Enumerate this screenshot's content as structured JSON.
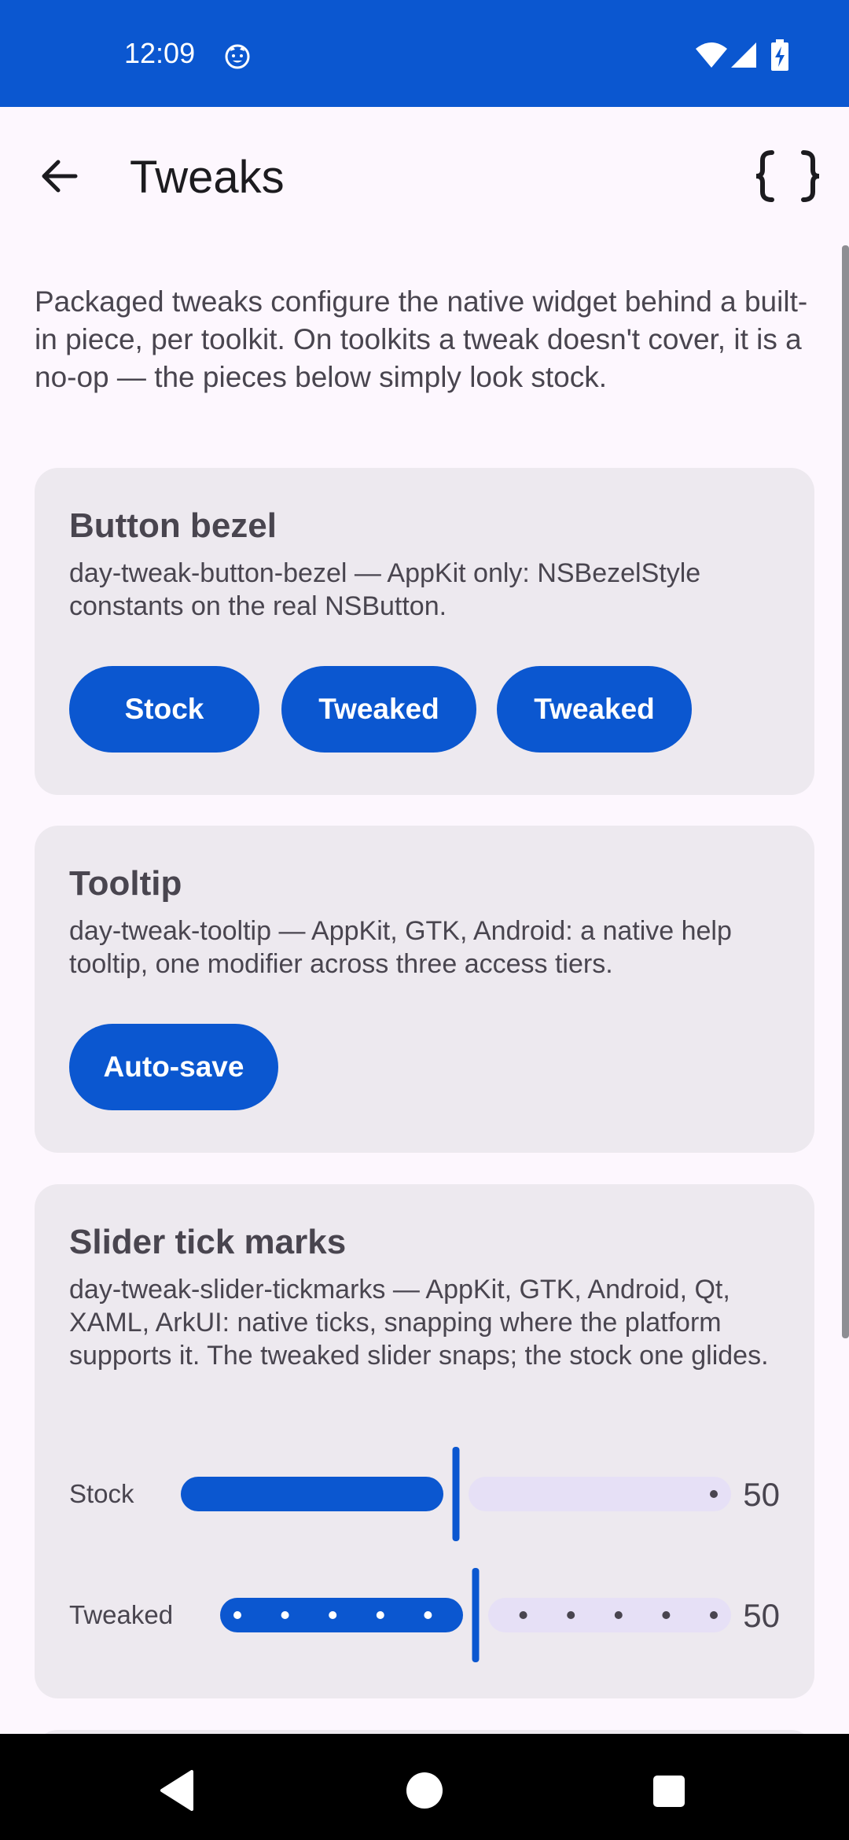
{
  "status_bar": {
    "time": "12:09",
    "icons": [
      "cat-notification-icon",
      "wifi-icon",
      "cellular-signal-icon",
      "battery-charging-icon"
    ],
    "background": "#0B57D0"
  },
  "app_bar": {
    "title": "Tweaks",
    "back_icon": "arrow-back-icon",
    "action_icon": "code-braces-icon"
  },
  "intro": "Packaged tweaks configure the native widget behind a built-in piece, per toolkit. On toolkits a tweak doesn't cover, it is a no-op — the pieces below simply look stock.",
  "cards": {
    "bezel": {
      "title": "Button bezel",
      "description": "day-tweak-button-bezel — AppKit only: NSBezelStyle constants on the real NSButton.",
      "buttons": [
        "Stock",
        "Tweaked",
        "Tweaked"
      ]
    },
    "tooltip": {
      "title": "Tooltip",
      "description": "day-tweak-tooltip — AppKit, GTK, Android: a native help tooltip, one modifier across three access tiers.",
      "button": "Auto-save"
    },
    "slider": {
      "title": "Slider tick marks",
      "description": "day-tweak-slider-tickmarks — AppKit, GTK, Android, Qt, XAML, ArkUI: native ticks, snapping where the platform supports it. The tweaked slider snaps; the stock one glides.",
      "stock": {
        "label": "Stock",
        "value": "50",
        "fraction": 0.5
      },
      "tweaked": {
        "label": "Tweaked",
        "value": "50",
        "fraction": 0.5,
        "ticks": 11
      }
    }
  },
  "colors": {
    "accent": "#0B57D0",
    "card": "#EDE9EF",
    "background": "#FDF7FE",
    "track_inactive": "#E6E0F6"
  },
  "nav_bar": {
    "icons": [
      "nav-back-icon",
      "nav-home-icon",
      "nav-recents-icon"
    ]
  }
}
